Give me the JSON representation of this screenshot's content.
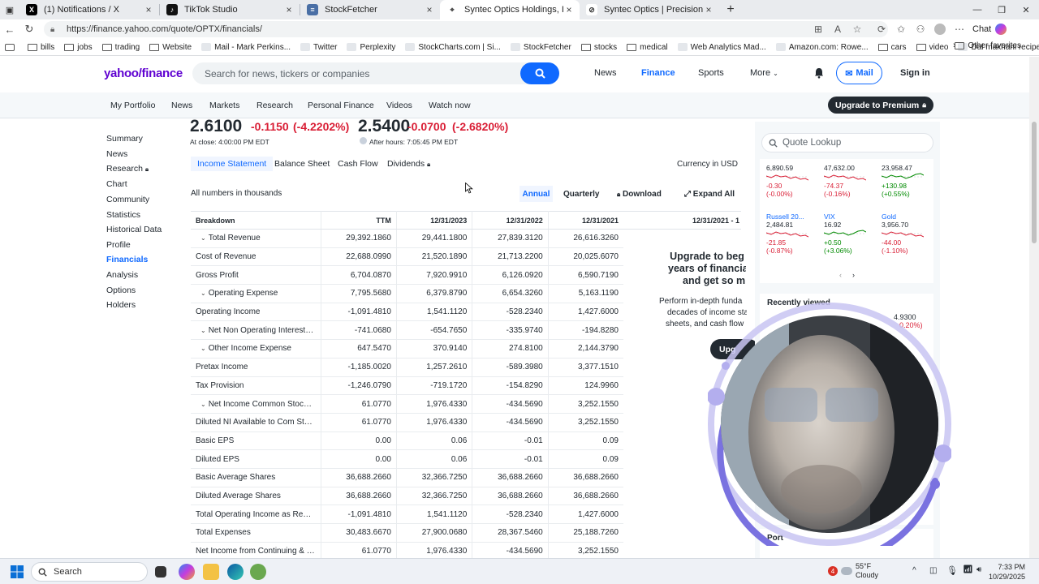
{
  "browser": {
    "tabs": [
      {
        "title": "(1) Notifications / X",
        "fav": "x-logo-icon",
        "active": false
      },
      {
        "title": "TikTok Studio",
        "fav": "tiktok-icon",
        "active": false
      },
      {
        "title": "StockFetcher",
        "fav": "stockfetcher-icon",
        "active": false
      },
      {
        "title": "Syntec Optics Holdings, Inc. (OPTX",
        "fav": "yahoo-icon",
        "active": true
      },
      {
        "title": "Syntec Optics | Precision Optics a",
        "fav": "globe-icon",
        "active": false
      }
    ],
    "url": "https://finance.yahoo.com/quote/OPTX/financials/",
    "chat_label": "Chat",
    "bookmarks": [
      {
        "label": "bills",
        "icon": "folder-icon"
      },
      {
        "label": "jobs",
        "icon": "folder-icon"
      },
      {
        "label": "trading",
        "icon": "folder-icon"
      },
      {
        "label": "Website",
        "icon": "folder-icon"
      },
      {
        "label": "Mail - Mark Perkins...",
        "icon": "mail-icon"
      },
      {
        "label": "Twitter",
        "icon": "x-logo-icon"
      },
      {
        "label": "Perplexity",
        "icon": "perplexity-icon"
      },
      {
        "label": "StockCharts.com | Si...",
        "icon": "stockcharts-icon"
      },
      {
        "label": "StockFetcher",
        "icon": "stockfetcher-icon"
      },
      {
        "label": "stocks",
        "icon": "folder-icon"
      },
      {
        "label": "medical",
        "icon": "folder-icon"
      },
      {
        "label": "Web Analytics Mad...",
        "icon": "globe-icon"
      },
      {
        "label": "Amazon.com: Rowe...",
        "icon": "amazon-icon"
      },
      {
        "label": "cars",
        "icon": "folder-icon"
      },
      {
        "label": "video",
        "icon": "folder-icon"
      },
      {
        "label": "Dal makhani recipe...",
        "icon": "recipe-icon"
      }
    ],
    "other_favorites": "Other favorites"
  },
  "yahoo": {
    "logo": "yahoo/finance",
    "search_placeholder": "Search for news, tickers or companies",
    "nav": [
      "News",
      "Finance",
      "Sports",
      "More"
    ],
    "mail": "Mail",
    "signin": "Sign in",
    "subnav": [
      "My Portfolio",
      "News",
      "Markets",
      "Research",
      "Personal Finance",
      "Videos",
      "Watch now"
    ],
    "premium": "Upgrade to Premium"
  },
  "leftnav": [
    {
      "label": "Summary",
      "active": false
    },
    {
      "label": "News",
      "active": false
    },
    {
      "label": "Research",
      "active": false,
      "lock": true
    },
    {
      "label": "Chart",
      "active": false
    },
    {
      "label": "Community",
      "active": false
    },
    {
      "label": "Statistics",
      "active": false
    },
    {
      "label": "Historical Data",
      "active": false
    },
    {
      "label": "Profile",
      "active": false
    },
    {
      "label": "Financials",
      "active": true
    },
    {
      "label": "Analysis",
      "active": false
    },
    {
      "label": "Options",
      "active": false
    },
    {
      "label": "Holders",
      "active": false
    }
  ],
  "quote": {
    "price": "2.6100",
    "change": "-0.1150",
    "change_pct": "(-4.2202%)",
    "close_note": "At close: 4:00:00 PM EDT",
    "ah_price": "2.5400",
    "ah_change": "-0.0700",
    "ah_change_pct": "(-2.6820%)",
    "ah_note": "After hours: 7:05:45 PM EDT"
  },
  "fin_tabs": [
    "Income Statement",
    "Balance Sheet",
    "Cash Flow",
    "Dividends"
  ],
  "currency": "Currency in USD",
  "numbers_note": "All numbers in thousands",
  "period_toggle": {
    "annual": "Annual",
    "quarterly": "Quarterly"
  },
  "download": "Download",
  "expand_all": "Expand All",
  "table": {
    "headers": [
      "Breakdown",
      "TTM",
      "12/31/2023",
      "12/31/2022",
      "12/31/2021",
      "12/31/2021 - 1"
    ],
    "rows": [
      {
        "label": "Total Revenue",
        "exp": true,
        "v": [
          "29,392.1860",
          "29,441.1800",
          "27,839.3120",
          "26,616.3260"
        ]
      },
      {
        "label": "Cost of Revenue",
        "exp": false,
        "v": [
          "22,688.0990",
          "21,520.1890",
          "21,713.2200",
          "20,025.6070"
        ]
      },
      {
        "label": "Gross Profit",
        "exp": false,
        "v": [
          "6,704.0870",
          "7,920.9910",
          "6,126.0920",
          "6,590.7190"
        ]
      },
      {
        "label": "Operating Expense",
        "exp": true,
        "v": [
          "7,795.5680",
          "6,379.8790",
          "6,654.3260",
          "5,163.1190"
        ]
      },
      {
        "label": "Operating Income",
        "exp": false,
        "v": [
          "-1,091.4810",
          "1,541.1120",
          "-528.2340",
          "1,427.6000"
        ]
      },
      {
        "label": "Net Non Operating Interest In...",
        "exp": true,
        "v": [
          "-741.0680",
          "-654.7650",
          "-335.9740",
          "-194.8280"
        ]
      },
      {
        "label": "Other Income Expense",
        "exp": true,
        "v": [
          "647.5470",
          "370.9140",
          "274.8100",
          "2,144.3790"
        ]
      },
      {
        "label": "Pretax Income",
        "exp": false,
        "v": [
          "-1,185.0020",
          "1,257.2610",
          "-589.3980",
          "3,377.1510"
        ]
      },
      {
        "label": "Tax Provision",
        "exp": false,
        "v": [
          "-1,246.0790",
          "-719.1720",
          "-154.8290",
          "124.9960"
        ]
      },
      {
        "label": "Net Income Common Stockho...",
        "exp": true,
        "v": [
          "61.0770",
          "1,976.4330",
          "-434.5690",
          "3,252.1550"
        ]
      },
      {
        "label": "Diluted NI Available to Com Stoc...",
        "exp": false,
        "v": [
          "61.0770",
          "1,976.4330",
          "-434.5690",
          "3,252.1550"
        ]
      },
      {
        "label": "Basic EPS",
        "exp": false,
        "v": [
          "0.00",
          "0.06",
          "-0.01",
          "0.09"
        ]
      },
      {
        "label": "Diluted EPS",
        "exp": false,
        "v": [
          "0.00",
          "0.06",
          "-0.01",
          "0.09"
        ]
      },
      {
        "label": "Basic Average Shares",
        "exp": false,
        "v": [
          "36,688.2660",
          "32,366.7250",
          "36,688.2660",
          "36,688.2660"
        ]
      },
      {
        "label": "Diluted Average Shares",
        "exp": false,
        "v": [
          "36,688.2660",
          "32,366.7250",
          "36,688.2660",
          "36,688.2660"
        ]
      },
      {
        "label": "Total Operating Income as Repor...",
        "exp": false,
        "v": [
          "-1,091.4810",
          "1,541.1120",
          "-528.2340",
          "1,427.6000"
        ]
      },
      {
        "label": "Total Expenses",
        "exp": false,
        "v": [
          "30,483.6670",
          "27,900.0680",
          "28,367.5460",
          "25,188.7260"
        ]
      },
      {
        "label": "Net Income from Continuing & D...",
        "exp": false,
        "v": [
          "61.0770",
          "1,976.4330",
          "-434.5690",
          "3,252.1550"
        ]
      }
    ]
  },
  "upsell": {
    "title1": "Upgrade to beg",
    "title2": "years of financia",
    "title3": "and get so m",
    "p1": "Perform in-depth funda",
    "p2": "decades of income sta",
    "p3": "sheets, and cash flow",
    "button": "Upg"
  },
  "right_panel": {
    "lookup_placeholder": "Quote Lookup",
    "markets": [
      {
        "name": "",
        "price": "6,890.59",
        "change": "-0.30",
        "pct": "(-0.00%)",
        "up": false
      },
      {
        "name": "",
        "price": "47,632.00",
        "change": "-74.37",
        "pct": "(-0.16%)",
        "up": false
      },
      {
        "name": "",
        "price": "23,958.47",
        "change": "+130.98",
        "pct": "(+0.55%)",
        "up": true
      },
      {
        "name": "Russell 20...",
        "price": "2,484.81",
        "change": "-21.85",
        "pct": "(-0.87%)",
        "up": false
      },
      {
        "name": "VIX",
        "price": "16.92",
        "change": "+0.50",
        "pct": "(+3.06%)",
        "up": true
      },
      {
        "name": "Gold",
        "price": "3,956.70",
        "change": "-44.00",
        "pct": "(-1.10%)",
        "up": false
      }
    ],
    "recently_viewed": "Recently viewed",
    "recent_values": [
      "4.9300",
      "0.20%)"
    ],
    "portfolio_label": "Port"
  },
  "taskbar": {
    "search": "Search",
    "weather_temp": "55°F",
    "weather_desc": "Cloudy",
    "weather_badge": "4",
    "time": "7:33 PM",
    "date": "10/29/2025"
  },
  "colors": {
    "accent": "#0f69ff",
    "negative": "#d91e35",
    "positive": "#008a00",
    "yahoo_purple": "#5f01d1"
  }
}
